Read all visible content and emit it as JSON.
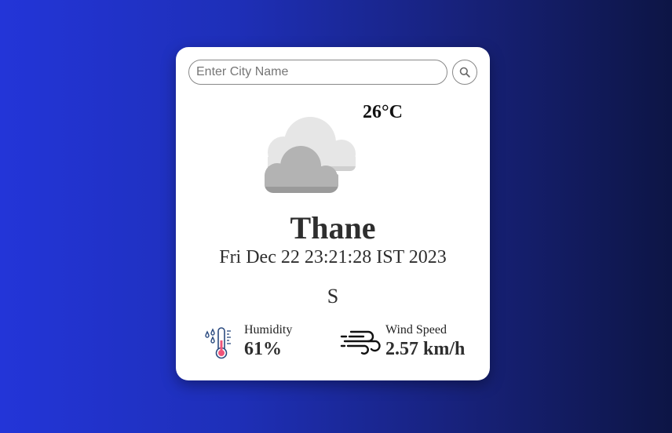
{
  "search": {
    "placeholder": "Enter City Name",
    "value": "",
    "button_icon": "search-icon"
  },
  "weather": {
    "icon": "cloudy-icon",
    "temperature": "26°C",
    "city": "Thane",
    "datetime": "Fri Dec 22 23:21:28 IST 2023",
    "description": "S"
  },
  "humidity": {
    "icon": "thermometer-humidity-icon",
    "label": "Humidity",
    "value": "61%"
  },
  "wind": {
    "icon": "wind-icon",
    "label": "Wind Speed",
    "value": "2.57 km/h"
  },
  "colors": {
    "background_start": "#2335d8",
    "background_end": "#0d1545",
    "card": "#ffffff",
    "text": "#2e2e2e"
  }
}
